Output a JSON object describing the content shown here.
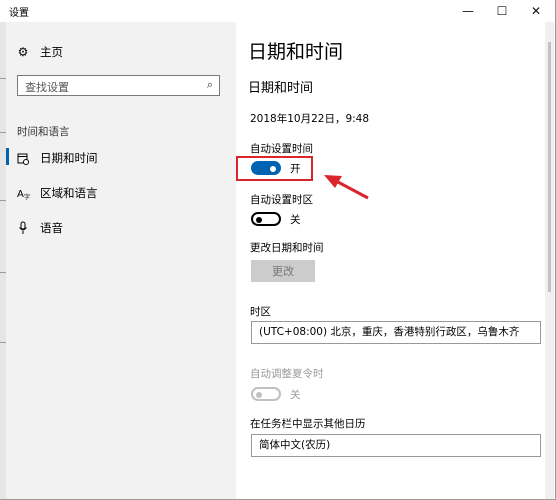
{
  "window": {
    "title": "设置",
    "controls": {
      "minimize": "—",
      "maximize": "☐",
      "close": "✕"
    }
  },
  "sidebar": {
    "home": {
      "label": "主页",
      "icon": "gear-icon"
    },
    "search": {
      "placeholder": "查找设置",
      "icon": "search-icon"
    },
    "section_label": "时间和语言",
    "items": [
      {
        "label": "日期和时间",
        "icon": "clock-calendar-icon",
        "active": true
      },
      {
        "label": "区域和语言",
        "icon": "language-icon",
        "active": false
      },
      {
        "label": "语音",
        "icon": "microphone-icon",
        "active": false
      }
    ]
  },
  "content": {
    "page_title": "日期和时间",
    "section_title": "日期和时间",
    "current_datetime": "2018年10月22日，9:48",
    "auto_time": {
      "label": "自动设置时间",
      "state": "开",
      "on": true
    },
    "auto_timezone": {
      "label": "自动设置时区",
      "state": "关",
      "on": false
    },
    "change_datetime": {
      "label": "更改日期和时间",
      "button": "更改"
    },
    "timezone": {
      "label": "时区",
      "value": "(UTC+08:00) 北京，重庆，香港特别行政区，乌鲁木齐"
    },
    "dst": {
      "label": "自动调整夏令时",
      "state": "关",
      "on": false,
      "disabled": true
    },
    "taskbar_calendar": {
      "label": "在任务栏中显示其他日历",
      "value": "简体中文(农历)"
    }
  },
  "colors": {
    "accent": "#0063b1",
    "sidebar_bg": "#f2f2f2",
    "annotation_red": "#d9262c"
  }
}
